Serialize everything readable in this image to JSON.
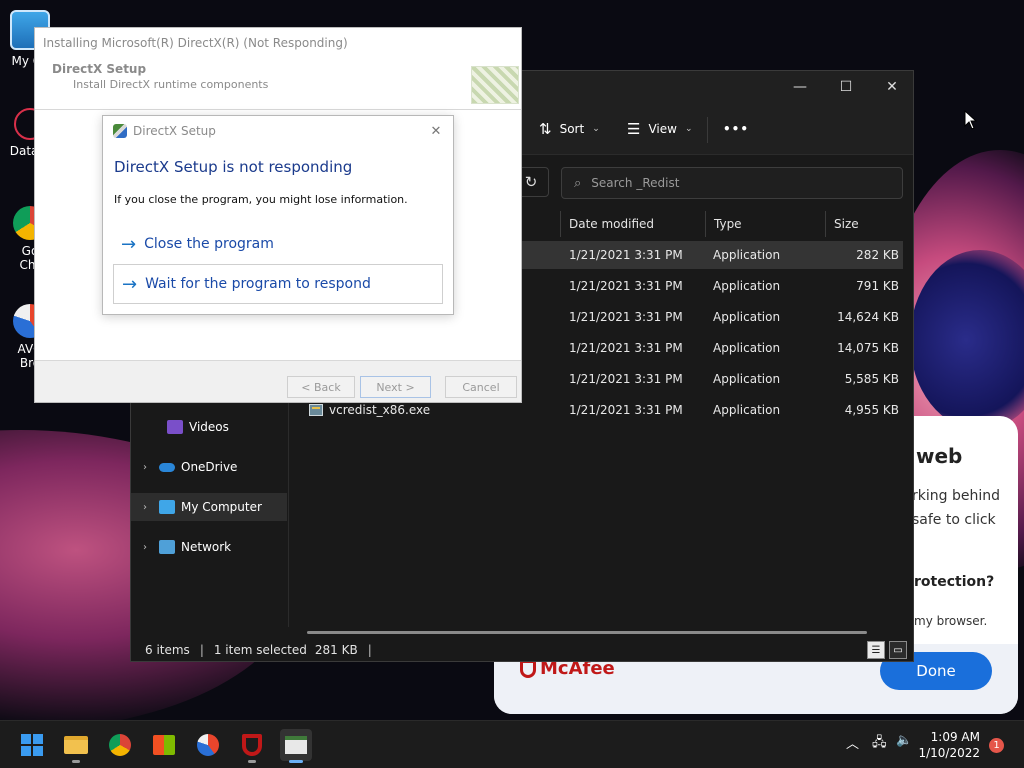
{
  "desktop": {
    "icons": [
      {
        "label": "My Co"
      },
      {
        "label": "DataW"
      },
      {
        "label": "Go",
        "label2": "Chr"
      },
      {
        "label": "AVG",
        "label2": "Bro"
      }
    ]
  },
  "mcafee": {
    "heading": "web",
    "line1": "rking behind",
    "line2": "safe to click",
    "question": "rotection?",
    "small": "my browser.",
    "logo": "McAfee",
    "done_label": "Done"
  },
  "explorer": {
    "cmd": {
      "sort_label": "Sort",
      "view_label": "View",
      "more_label": "•••"
    },
    "search_placeholder": "Search _Redist",
    "columns": {
      "date": "Date modified",
      "type": "Type",
      "size": "Size"
    },
    "files": [
      {
        "name": "",
        "date": "1/21/2021 3:31 PM",
        "type": "Application",
        "size": "282 KB"
      },
      {
        "name": "",
        "date": "1/21/2021 3:31 PM",
        "type": "Application",
        "size": "791 KB"
      },
      {
        "name": "",
        "date": "1/21/2021 3:31 PM",
        "type": "Application",
        "size": "14,624 KB"
      },
      {
        "name": "",
        "date": "1/21/2021 3:31 PM",
        "type": "Application",
        "size": "14,075 KB"
      },
      {
        "name": "",
        "date": "1/21/2021 3:31 PM",
        "type": "Application",
        "size": "5,585 KB"
      },
      {
        "name": "vcredist_x86.exe",
        "date": "1/21/2021 3:31 PM",
        "type": "Application",
        "size": "4,955 KB"
      }
    ],
    "nav": {
      "videos": "Videos",
      "onedrive": "OneDrive",
      "my_computer": "My Computer",
      "network": "Network"
    },
    "status": {
      "items": "6 items",
      "selected": "1 item selected",
      "size": "281 KB"
    }
  },
  "dx_window": {
    "title": "Installing Microsoft(R) DirectX(R) (Not Responding)",
    "header_title": "DirectX Setup",
    "header_sub": "Install DirectX runtime components",
    "back_label": "< Back",
    "next_label": "Next >",
    "cancel_label": "Cancel"
  },
  "not_responding": {
    "title": "DirectX Setup",
    "heading": "DirectX Setup is not responding",
    "message": "If you close the program, you might lose information.",
    "close_option": "Close the program",
    "wait_option": "Wait for the program to respond"
  },
  "taskbar": {
    "time": "1:09 AM",
    "date": "1/10/2022",
    "notification_count": "1"
  },
  "colors": {
    "accent_blue": "#1a6fdb",
    "link_blue": "#1a4aa8",
    "mcafee_red": "#c01818",
    "explorer_bg": "#191919"
  }
}
